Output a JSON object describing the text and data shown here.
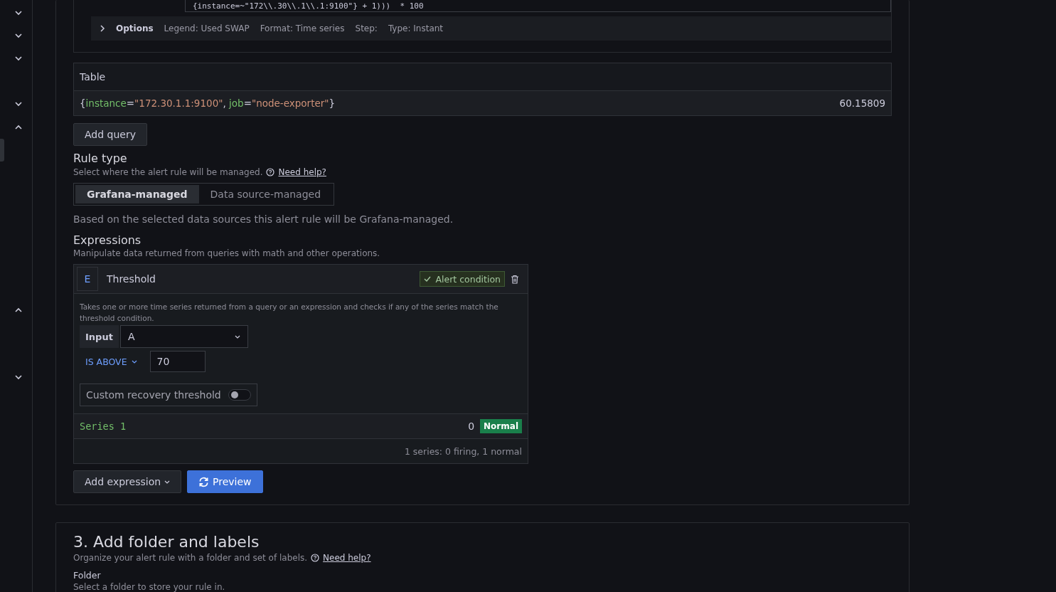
{
  "sidebar": {
    "toggles": [
      {
        "expanded": false
      },
      {
        "expanded": false
      },
      {
        "expanded": false
      },
      {
        "expanded": false
      },
      {
        "expanded": true
      },
      {
        "expanded": true
      },
      {
        "expanded": false
      }
    ]
  },
  "query": {
    "expression_tail": "{instance=~\"172\\\\.30\\\\.1\\\\.1:9100\"} + 1)))  * 100",
    "options_label": "Options",
    "options": [
      "Legend: Used SWAP",
      "Format: Time series",
      "Step:",
      "Type: Instant"
    ]
  },
  "table": {
    "title": "Table",
    "rows": [
      {
        "labels": [
          {
            "text": "{",
            "kind": "punct"
          },
          {
            "text": "instance",
            "kind": "key"
          },
          {
            "text": "=",
            "kind": "punct"
          },
          {
            "text": "\"172.30.1.1:9100\"",
            "kind": "value"
          },
          {
            "text": ", ",
            "kind": "punct"
          },
          {
            "text": "job",
            "kind": "key"
          },
          {
            "text": "=",
            "kind": "punct"
          },
          {
            "text": "\"node-exporter\"",
            "kind": "value"
          },
          {
            "text": "}",
            "kind": "punct"
          }
        ],
        "value": "60.15809"
      }
    ]
  },
  "add_query": "Add query",
  "rule_type": {
    "title": "Rule type",
    "description": "Select where the alert rule will be managed.",
    "help": "Need help?",
    "options": [
      {
        "label": "Grafana-managed",
        "selected": true
      },
      {
        "label": "Data source-managed",
        "selected": false
      }
    ],
    "note": "Based on the selected data sources this alert rule will be Grafana-managed."
  },
  "expressions": {
    "title": "Expressions",
    "description": "Manipulate data returned from queries with math and other operations.",
    "items": [
      {
        "ref": "E",
        "name": "Threshold",
        "alert_condition": "Alert condition",
        "is_condition": true,
        "description": "Takes one or more time series returned from a query or an expression and checks if any of the series match the threshold condition.",
        "input_label": "Input",
        "input": "A",
        "operator": "IS ABOVE",
        "threshold": "70",
        "recovery_label": "Custom recovery threshold",
        "recovery_on": false,
        "series": [
          {
            "name": "Series 1",
            "value": "0",
            "state": "Normal",
            "color": "#1a7f4b"
          }
        ],
        "summary": "1 series: 0 firing, 1 normal"
      }
    ],
    "add_expression": "Add expression",
    "preview": "Preview"
  },
  "section3": {
    "title": "3. Add folder and labels",
    "description": "Organize your alert rule with a folder and set of labels.",
    "help": "Need help?",
    "folder_label": "Folder",
    "folder_description": "Select a folder to store your rule in."
  }
}
